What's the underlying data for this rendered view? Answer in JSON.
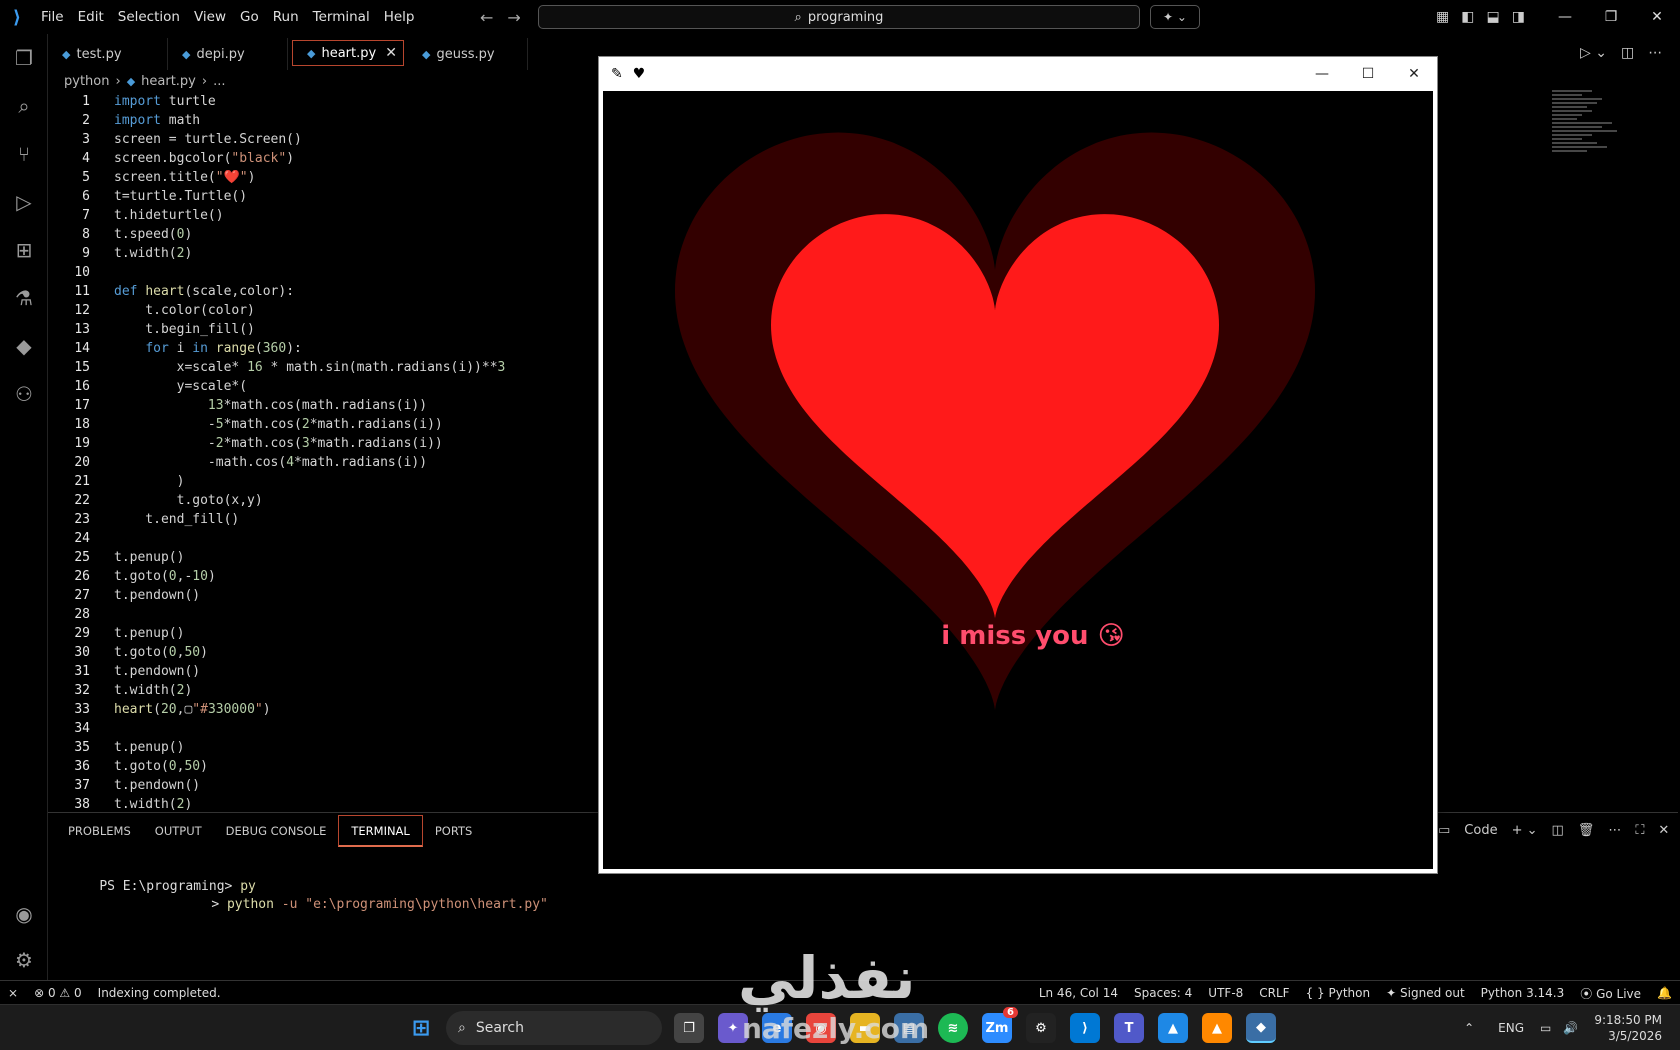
{
  "menu": [
    "File",
    "Edit",
    "Selection",
    "View",
    "Go",
    "Run",
    "Terminal",
    "Help"
  ],
  "search": {
    "text": "programing"
  },
  "tabs": [
    {
      "label": "test.py"
    },
    {
      "label": "depi.py"
    },
    {
      "label": "heart.py"
    },
    {
      "label": "geuss.py"
    }
  ],
  "breadcrumb": {
    "folder": "python",
    "file": "heart.py",
    "more": "..."
  },
  "code_lines": [
    {
      "n": "1",
      "text": "import turtle"
    },
    {
      "n": "2",
      "text": "import math"
    },
    {
      "n": "3",
      "text": "screen = turtle.Screen()"
    },
    {
      "n": "4",
      "text": "screen.bgcolor(\"black\")"
    },
    {
      "n": "5",
      "text": "screen.title(\"❤️\")"
    },
    {
      "n": "6",
      "text": "t=turtle.Turtle()"
    },
    {
      "n": "7",
      "text": "t.hideturtle()"
    },
    {
      "n": "8",
      "text": "t.speed(0)"
    },
    {
      "n": "9",
      "text": "t.width(2)"
    },
    {
      "n": "10",
      "text": ""
    },
    {
      "n": "11",
      "text": "def heart(scale,color):"
    },
    {
      "n": "12",
      "text": "    t.color(color)"
    },
    {
      "n": "13",
      "text": "    t.begin_fill()"
    },
    {
      "n": "14",
      "text": "    for i in range(360):"
    },
    {
      "n": "15",
      "text": "        x=scale* 16 * math.sin(math.radians(i))**3"
    },
    {
      "n": "16",
      "text": "        y=scale*("
    },
    {
      "n": "17",
      "text": "            13*math.cos(math.radians(i))"
    },
    {
      "n": "18",
      "text": "            -5*math.cos(2*math.radians(i))"
    },
    {
      "n": "19",
      "text": "            -2*math.cos(3*math.radians(i))"
    },
    {
      "n": "20",
      "text": "            -math.cos(4*math.radians(i))"
    },
    {
      "n": "21",
      "text": "        )"
    },
    {
      "n": "22",
      "text": "        t.goto(x,y)"
    },
    {
      "n": "23",
      "text": "    t.end_fill()"
    },
    {
      "n": "24",
      "text": ""
    },
    {
      "n": "25",
      "text": "t.penup()"
    },
    {
      "n": "26",
      "text": "t.goto(0,-10)"
    },
    {
      "n": "27",
      "text": "t.pendown()"
    },
    {
      "n": "28",
      "text": ""
    },
    {
      "n": "29",
      "text": "t.penup()"
    },
    {
      "n": "30",
      "text": "t.goto(0,50)"
    },
    {
      "n": "31",
      "text": "t.pendown()"
    },
    {
      "n": "32",
      "text": "t.width(2)"
    },
    {
      "n": "33",
      "text": "heart(20,▢\"#330000\")"
    },
    {
      "n": "34",
      "text": ""
    },
    {
      "n": "35",
      "text": "t.penup()"
    },
    {
      "n": "36",
      "text": "t.goto(0,50)"
    },
    {
      "n": "37",
      "text": "t.pendown()"
    },
    {
      "n": "38",
      "text": "t.width(2)"
    }
  ],
  "panel": {
    "tabs": [
      "PROBLEMS",
      "OUTPUT",
      "DEBUG CONSOLE",
      "TERMINAL",
      "PORTS"
    ],
    "active_tab": "TERMINAL",
    "shell_label": "Code"
  },
  "terminal": {
    "line1_prompt": "PS E:\\programing>",
    "line1_cmd": "py",
    "line2_prefix": ">",
    "line2_cmd": "python",
    "line2_args": "-u \"e:\\programing\\python\\heart.py\""
  },
  "turtle_window": {
    "title_icons": [
      "feather-icon",
      "heart-icon"
    ],
    "message": "i miss you 😘",
    "outer_heart_color": "#330000",
    "inner_heart_color": "#ff1a1a",
    "message_color": "#ff4d6d"
  },
  "status": {
    "errors": "0",
    "warnings": "0",
    "message": "Indexing completed.",
    "position": "Ln 46, Col 14",
    "spaces": "Spaces: 4",
    "encoding": "UTF-8",
    "eol": "CRLF",
    "language": "Python",
    "account": "Signed out",
    "interpreter": "Python 3.14.3",
    "golive": "Go Live"
  },
  "taskbar": {
    "search_label": "Search",
    "lang": "ENG",
    "time": "9:18:50 PM",
    "date": "3/5/2026",
    "badge_count": "6"
  },
  "watermark": {
    "text": "نفذلي",
    "url": "nafezly.com"
  },
  "colors": {
    "keyword": "#569cd6",
    "string": "#ce9178",
    "function": "#dcdcaa",
    "number": "#b5cea8",
    "accent": "#b8462e"
  }
}
